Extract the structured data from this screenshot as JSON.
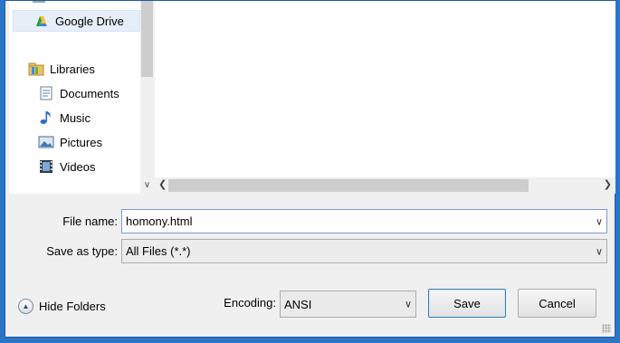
{
  "nav": {
    "items": [
      {
        "label": "Google Drive",
        "icon": "google-drive-icon"
      },
      {
        "label": "Libraries",
        "icon": "libraries-icon"
      },
      {
        "label": "Documents",
        "icon": "documents-icon"
      },
      {
        "label": "Music",
        "icon": "music-icon"
      },
      {
        "label": "Pictures",
        "icon": "pictures-icon"
      },
      {
        "label": "Videos",
        "icon": "videos-icon"
      }
    ]
  },
  "form": {
    "filename_label": "File name:",
    "filename_value": "homony.html",
    "savetype_label": "Save as type:",
    "savetype_value": "All Files  (*.*)",
    "encoding_label": "Encoding:",
    "encoding_value": "ANSI"
  },
  "footer": {
    "hide_folders": "Hide Folders",
    "save": "Save",
    "cancel": "Cancel"
  },
  "colors": {
    "window_frame": "#2b75c9",
    "dialog_bg": "#f0f0f0",
    "field_border": "#7a9cc8"
  }
}
